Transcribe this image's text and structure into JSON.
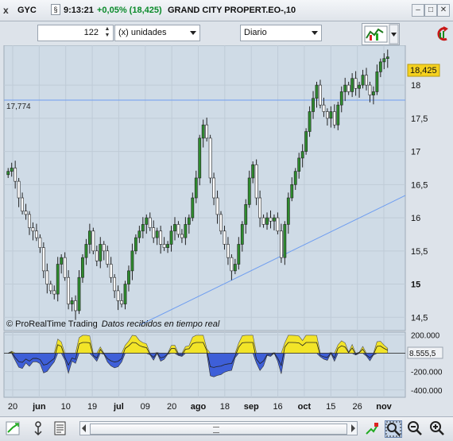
{
  "titlebar": {
    "close_glyph": "x",
    "ticker": "GYC",
    "link_glyph": "§",
    "time": "9:13:21",
    "change": "+0,05% (18,425)",
    "name": "GRAND CITY PROPERT.EO-,10",
    "minimize_glyph": "‒",
    "restore_glyph": "□",
    "close2_glyph": "✕"
  },
  "toolbar": {
    "units_value": "122",
    "units_type": "(x) unidades",
    "period": "Diario"
  },
  "price_chart": {
    "watermark": "© ProRealTime Trading",
    "watermark_note": "Datos recibidos en tiempo real",
    "last_price_label": "18,425",
    "hline_label": "17,774",
    "y_ticks": [
      "18",
      "17,5",
      "17",
      "16,5",
      "16",
      "15,5",
      "15",
      "14,5"
    ]
  },
  "indicator": {
    "last_value_label": "8.555,5",
    "y_ticks": [
      "200.000",
      "-200.000",
      "-400.000"
    ]
  },
  "x_ticks": [
    "20",
    "jun",
    "10",
    "19",
    "jul",
    "09",
    "20",
    "ago",
    "18",
    "sep",
    "16",
    "oct",
    "15",
    "26",
    "nov"
  ],
  "chart_data": [
    {
      "type": "candlestick",
      "hline": 17.774,
      "last": 18.425,
      "ylim": [
        14.3,
        18.6
      ],
      "closes": [
        16.7,
        16.75,
        16.55,
        16.3,
        16.1,
        16.05,
        15.85,
        15.8,
        15.7,
        15.55,
        15.2,
        15.0,
        14.9,
        14.85,
        15.3,
        15.4,
        15.1,
        14.7,
        14.75,
        14.6,
        15.1,
        15.4,
        15.6,
        15.8,
        15.5,
        15.35,
        15.6,
        15.5,
        15.3,
        15.1,
        14.9,
        14.75,
        14.7,
        15.0,
        15.2,
        15.5,
        15.7,
        15.8,
        15.9,
        16.0,
        15.85,
        15.7,
        15.8,
        15.6,
        15.55,
        15.6,
        15.8,
        15.9,
        15.75,
        15.7,
        15.9,
        16.0,
        16.3,
        16.6,
        17.2,
        17.4,
        17.2,
        16.6,
        16.3,
        16.05,
        15.8,
        15.6,
        15.4,
        15.2,
        15.3,
        15.6,
        15.9,
        16.2,
        16.6,
        16.8,
        16.3,
        16.0,
        15.9,
        16.0,
        15.95,
        16.0,
        15.8,
        15.4,
        15.9,
        16.3,
        16.5,
        16.7,
        16.9,
        17.0,
        17.3,
        17.6,
        17.8,
        18.0,
        17.7,
        17.6,
        17.5,
        17.6,
        17.4,
        17.7,
        17.9,
        18.0,
        17.9,
        18.1,
        17.95,
        18.0,
        18.15,
        18.0,
        17.85,
        17.9,
        18.2,
        18.35,
        18.4,
        18.425
      ]
    },
    {
      "type": "area",
      "last": 8555.5,
      "ylim": [
        -480000,
        230000
      ]
    }
  ],
  "statusbar": {
    "scroll_grip": "≡"
  }
}
